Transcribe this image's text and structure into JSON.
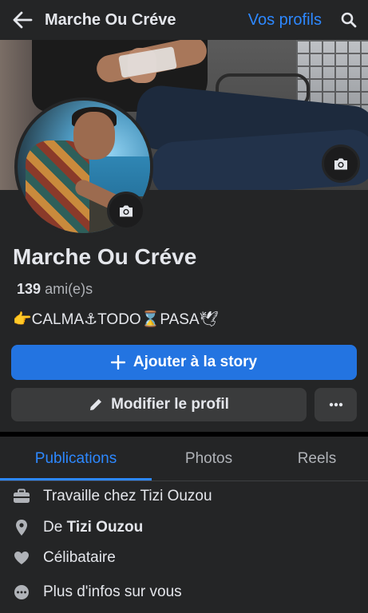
{
  "topbar": {
    "back_icon": "arrow-left-icon",
    "title": "Marche Ou Créve",
    "profiles_link": "Vos profils",
    "search_icon": "search-icon"
  },
  "profile": {
    "name": "Marche Ou Créve",
    "friends_count": "139",
    "friends_label": "ami(e)s",
    "bio": "👉CALMA⚓TODO⌛PASA🕊"
  },
  "actions": {
    "add_story_label": "Ajouter à la story",
    "edit_profile_label": "Modifier le profil",
    "more_icon": "more-dots-icon"
  },
  "tabs": [
    {
      "label": "Publications",
      "active": true
    },
    {
      "label": "Photos",
      "active": false
    },
    {
      "label": "Reels",
      "active": false
    }
  ],
  "details": {
    "work": "Travaille chez Tizi Ouzou",
    "from_prefix": "De",
    "from_place": "Tizi Ouzou",
    "relationship": "Célibataire",
    "more_info": "Plus d'infos sur vous"
  },
  "colors": {
    "accent": "#2d88ff",
    "primary_button": "#2374e1",
    "background": "#242526",
    "secondary_button": "#3a3b3c"
  }
}
